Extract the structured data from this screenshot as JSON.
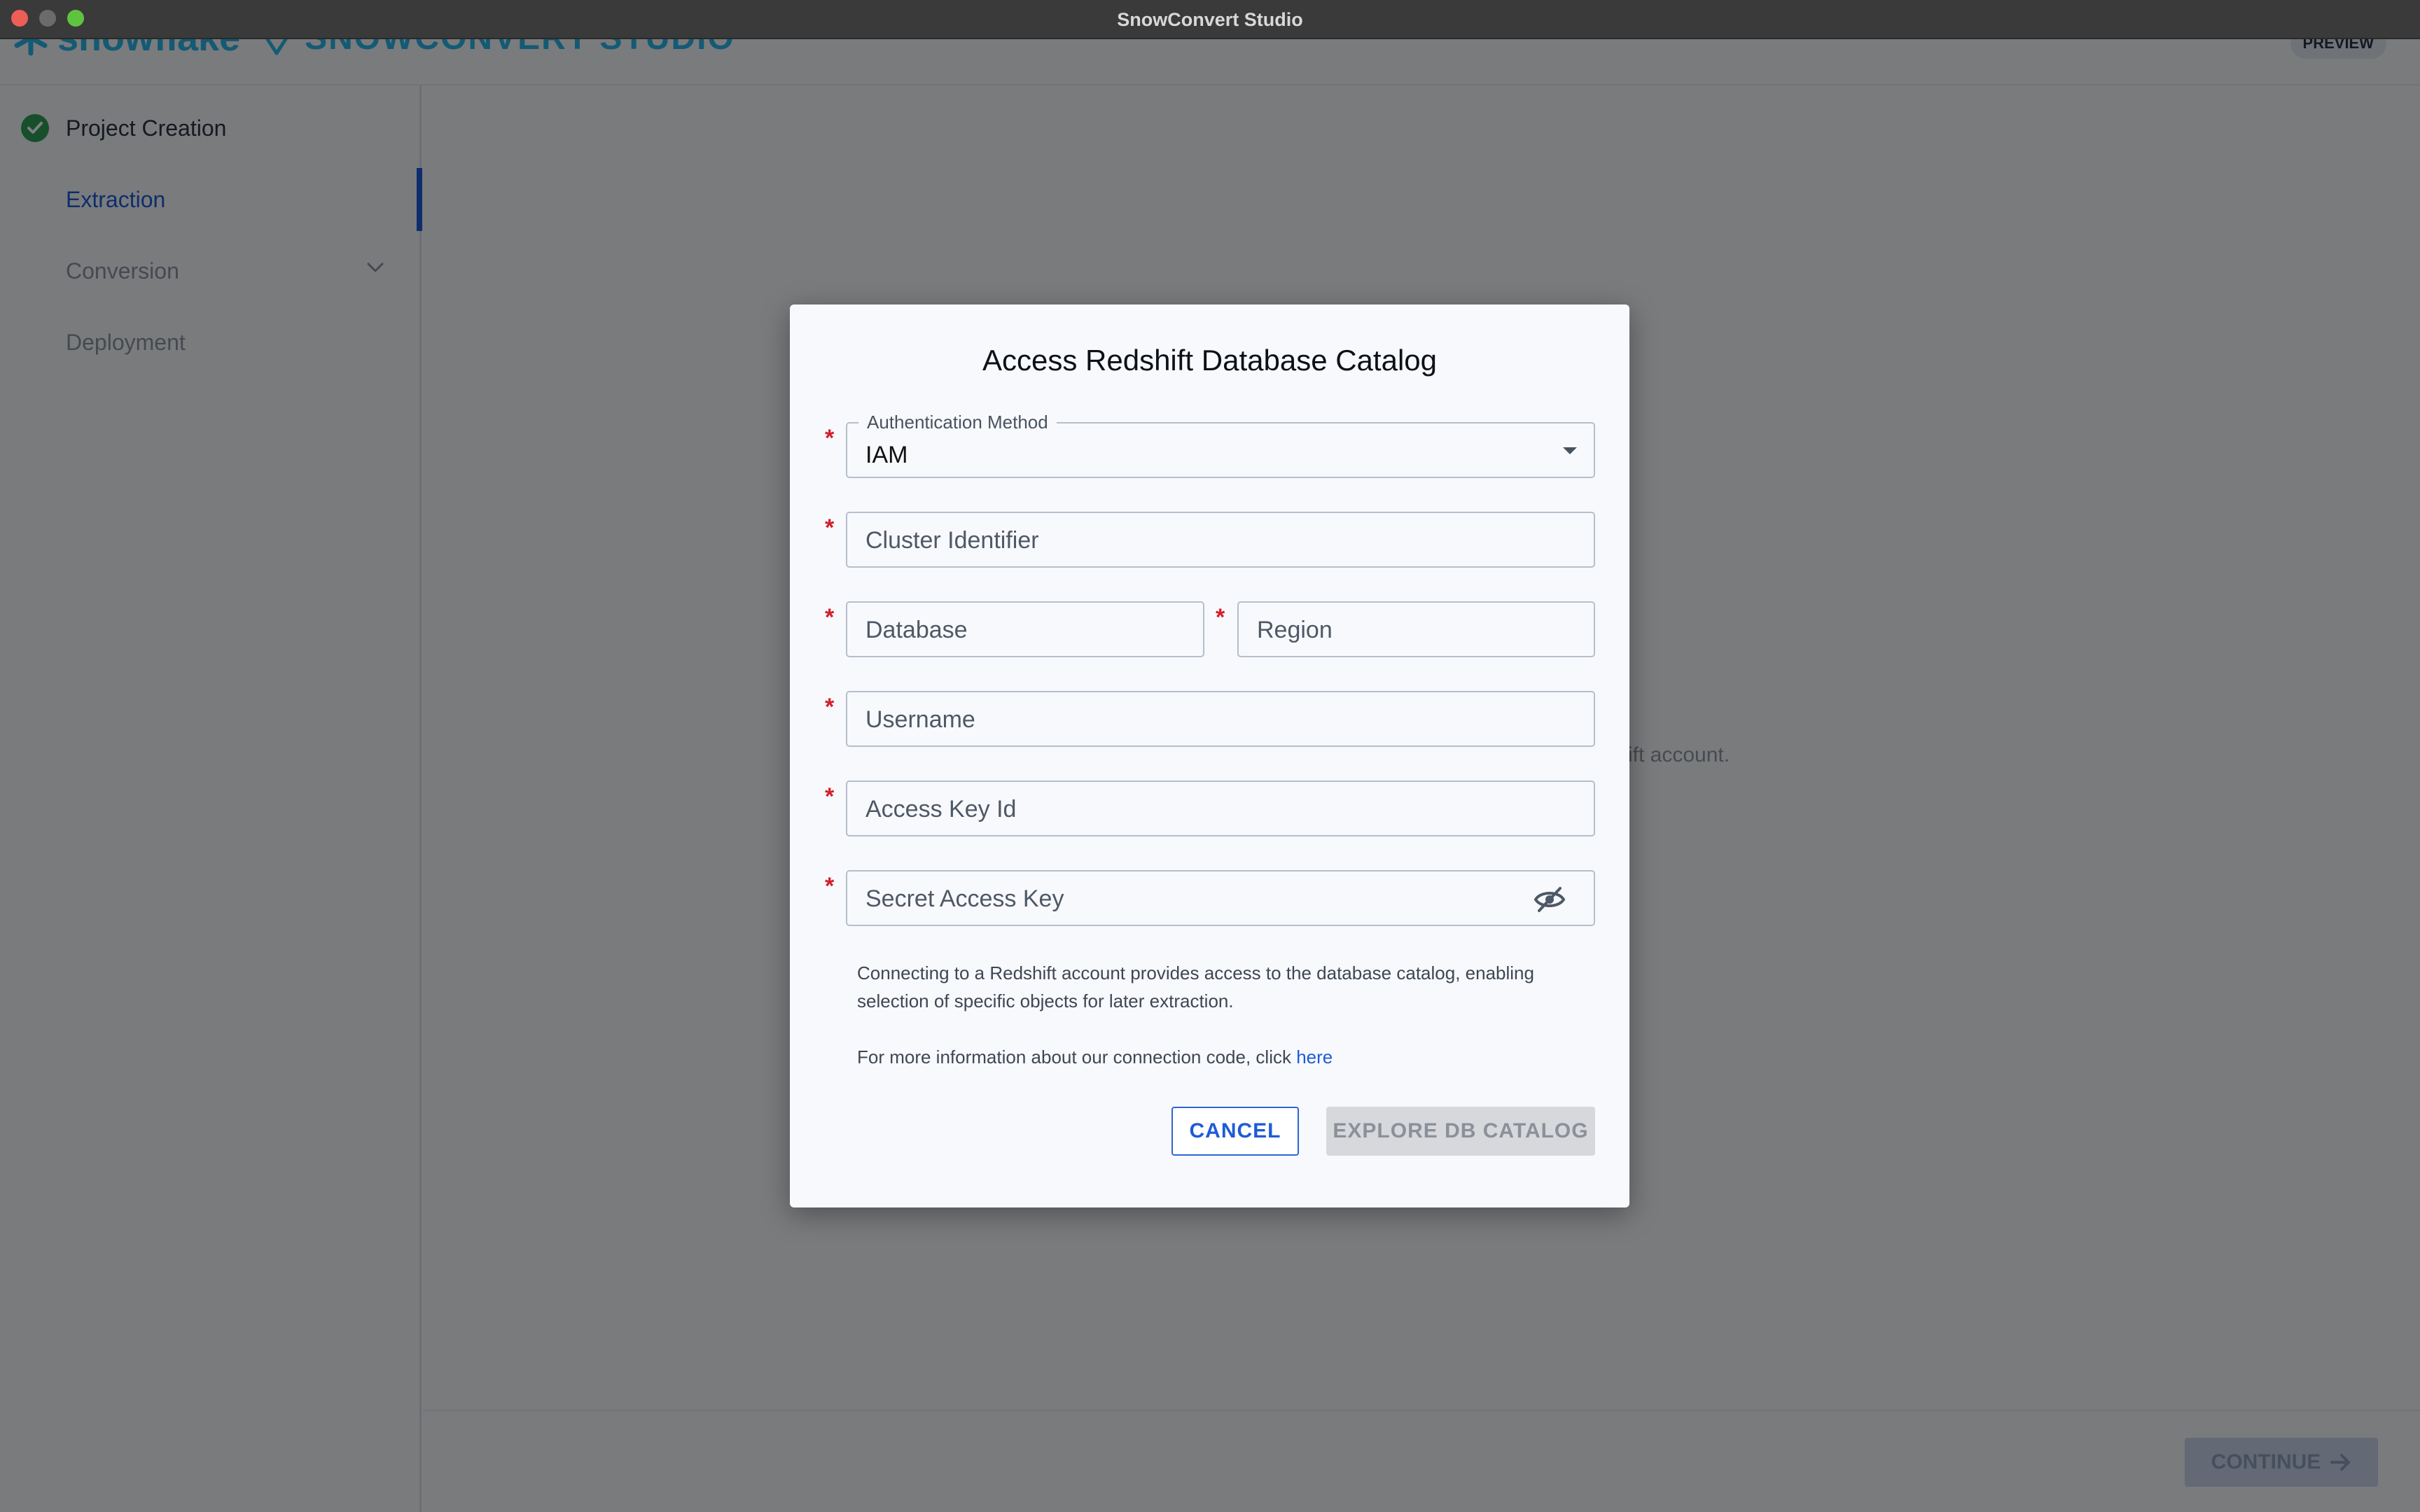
{
  "window": {
    "title": "SnowConvert Studio"
  },
  "header": {
    "brand": "snowflake",
    "product": "SNOWCONVERT STUDIO",
    "badge": "PREVIEW"
  },
  "sidebar": {
    "items": [
      {
        "label": "Project Creation",
        "state": "done"
      },
      {
        "label": "Extraction",
        "state": "active"
      },
      {
        "label": "Conversion",
        "state": "inactive"
      },
      {
        "label": "Deployment",
        "state": "inactive"
      }
    ]
  },
  "main": {
    "background_text": "ift account."
  },
  "footer": {
    "continue_label": "CONTINUE"
  },
  "modal": {
    "title": "Access Redshift Database Catalog",
    "auth_method": {
      "label": "Authentication Method",
      "value": "IAM"
    },
    "cluster_identifier": {
      "placeholder": "Cluster Identifier"
    },
    "database": {
      "placeholder": "Database"
    },
    "region": {
      "placeholder": "Region"
    },
    "username": {
      "placeholder": "Username"
    },
    "access_key_id": {
      "placeholder": "Access Key Id"
    },
    "secret_access_key": {
      "placeholder": "Secret Access Key"
    },
    "description": "Connecting to a Redshift account provides access to the database catalog, enabling selection of specific objects for later extraction.",
    "more_info_text": "For more information about our connection code, click ",
    "more_info_link": "here",
    "cancel_label": "CANCEL",
    "explore_label": "EXPLORE DB CATALOG"
  },
  "colors": {
    "accent": "#1f5bd8",
    "required": "#d21f2b",
    "success": "#2e9e5b",
    "brand": "#29b5e8"
  }
}
